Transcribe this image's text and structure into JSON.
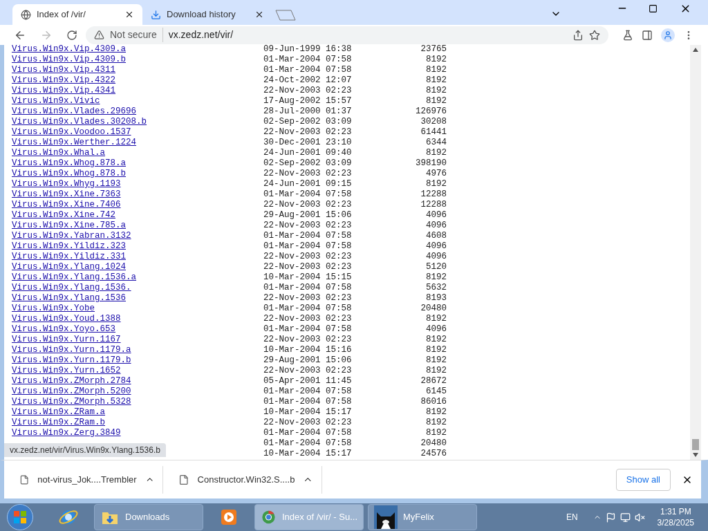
{
  "tabs": [
    {
      "title": "Index of /vir/",
      "selected": true,
      "kind": "page"
    },
    {
      "title": "Download history",
      "selected": false,
      "kind": "download"
    }
  ],
  "address": {
    "security": "Not secure",
    "url": "vx.zedz.net/vir/"
  },
  "rows": [
    {
      "name": "Virus.Win9x.Vip.4309.a",
      "date": "09-Jun-1999 16:38",
      "size": "23765"
    },
    {
      "name": "Virus.Win9x.Vip.4309.b",
      "date": "01-Mar-2004 07:58",
      "size": "8192"
    },
    {
      "name": "Virus.Win9x.Vip.4311",
      "date": "01-Mar-2004 07:58",
      "size": "8192"
    },
    {
      "name": "Virus.Win9x.Vip.4322",
      "date": "24-Oct-2002 12:07",
      "size": "8192"
    },
    {
      "name": "Virus.Win9x.Vip.4341",
      "date": "22-Nov-2003 02:23",
      "size": "8192"
    },
    {
      "name": "Virus.Win9x.Vivic",
      "date": "17-Aug-2002 15:57",
      "size": "8192"
    },
    {
      "name": "Virus.Win9x.Vlades.29696",
      "date": "28-Jul-2000 01:37",
      "size": "126976"
    },
    {
      "name": "Virus.Win9x.Vlades.30208.b",
      "date": "02-Sep-2002 03:09",
      "size": "30208"
    },
    {
      "name": "Virus.Win9x.Voodoo.1537",
      "date": "22-Nov-2003 02:23",
      "size": "61441"
    },
    {
      "name": "Virus.Win9x.Werther.1224",
      "date": "30-Dec-2001 23:10",
      "size": "6344"
    },
    {
      "name": "Virus.Win9x.Whal.a",
      "date": "24-Jun-2001 09:40",
      "size": "8192"
    },
    {
      "name": "Virus.Win9x.Whog.878.a",
      "date": "02-Sep-2002 03:09",
      "size": "398190"
    },
    {
      "name": "Virus.Win9x.Whog.878.b",
      "date": "22-Nov-2003 02:23",
      "size": "4976"
    },
    {
      "name": "Virus.Win9x.Whyg.1193",
      "date": "24-Jun-2001 09:15",
      "size": "8192"
    },
    {
      "name": "Virus.Win9x.Xine.7363",
      "date": "01-Mar-2004 07:58",
      "size": "12288"
    },
    {
      "name": "Virus.Win9x.Xine.7406",
      "date": "22-Nov-2003 02:23",
      "size": "12288"
    },
    {
      "name": "Virus.Win9x.Xine.742",
      "date": "29-Aug-2001 15:06",
      "size": "4096"
    },
    {
      "name": "Virus.Win9x.Xine.785.a",
      "date": "22-Nov-2003 02:23",
      "size": "4096"
    },
    {
      "name": "Virus.Win9x.Yabran.3132",
      "date": "01-Mar-2004 07:58",
      "size": "4608"
    },
    {
      "name": "Virus.Win9x.Yildiz.323",
      "date": "01-Mar-2004 07:58",
      "size": "4096"
    },
    {
      "name": "Virus.Win9x.Yildiz.331",
      "date": "22-Nov-2003 02:23",
      "size": "4096"
    },
    {
      "name": "Virus.Win9x.Ylang.1024",
      "date": "22-Nov-2003 02:23",
      "size": "5120"
    },
    {
      "name": "Virus.Win9x.Ylang.1536.a",
      "date": "10-Mar-2004 15:15",
      "size": "8192"
    },
    {
      "name": "Virus.Win9x.Ylang.1536.",
      "date": "01-Mar-2004 07:58",
      "size": "5632"
    },
    {
      "name": "Virus.Win9x.Ylang.1536",
      "date": "22-Nov-2003 02:23",
      "size": "8193"
    },
    {
      "name": "Virus.Win9x.Yobe",
      "date": "01-Mar-2004 07:58",
      "size": "20480"
    },
    {
      "name": "Virus.Win9x.Youd.1388",
      "date": "22-Nov-2003 02:23",
      "size": "8192"
    },
    {
      "name": "Virus.Win9x.Yoyo.653",
      "date": "01-Mar-2004 07:58",
      "size": "4096"
    },
    {
      "name": "Virus.Win9x.Yurn.1167",
      "date": "22-Nov-2003 02:23",
      "size": "8192"
    },
    {
      "name": "Virus.Win9x.Yurn.1179.a",
      "date": "10-Mar-2004 15:16",
      "size": "8192"
    },
    {
      "name": "Virus.Win9x.Yurn.1179.b",
      "date": "29-Aug-2001 15:06",
      "size": "8192"
    },
    {
      "name": "Virus.Win9x.Yurn.1652",
      "date": "22-Nov-2003 02:23",
      "size": "8192"
    },
    {
      "name": "Virus.Win9x.ZMorph.2784",
      "date": "05-Apr-2001 11:45",
      "size": "28672"
    },
    {
      "name": "Virus.Win9x.ZMorph.5200",
      "date": "01-Mar-2004 07:58",
      "size": "6145"
    },
    {
      "name": "Virus.Win9x.ZMorph.5328",
      "date": "01-Mar-2004 07:58",
      "size": "86016"
    },
    {
      "name": "Virus.Win9x.ZRam.a",
      "date": "10-Mar-2004 15:17",
      "size": "8192"
    },
    {
      "name": "Virus.Win9x.ZRam.b",
      "date": "22-Nov-2003 02:23",
      "size": "8192"
    },
    {
      "name": "Virus.Win9x.Zerg.3849",
      "date": "01-Mar-2004 07:58",
      "size": "8192"
    },
    {
      "date": "01-Mar-2004 07:58",
      "size": "20480"
    },
    {
      "date": "10-Mar-2004 15:17",
      "size": "24576"
    }
  ],
  "status_url": "vx.zedz.net/vir/Virus.Win9x.Ylang.1536.b",
  "downloads": [
    {
      "filename": "not-virus_Jok....Trembler"
    },
    {
      "filename": "Constructor.Win32.S....b"
    }
  ],
  "show_all": "Show all",
  "taskbar": [
    {
      "kind": "ie"
    },
    {
      "kind": "folder",
      "label": "Downloads",
      "active": false
    },
    {
      "kind": "media"
    },
    {
      "kind": "chrome",
      "label": "Index of /vir/ - Su...",
      "active": true
    },
    {
      "kind": "cat",
      "label": "MyFelix",
      "active": false
    }
  ],
  "tray": {
    "language": "EN",
    "time": "1:31 PM",
    "date": "3/28/2025"
  }
}
